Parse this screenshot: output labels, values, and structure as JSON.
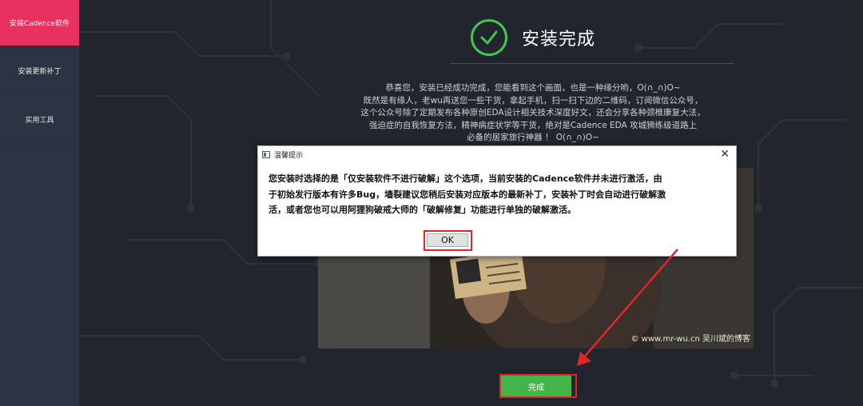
{
  "sidebar": {
    "items": [
      {
        "label": "安装Cadence软件",
        "active": true
      },
      {
        "label": "安装更新补丁",
        "active": false
      },
      {
        "label": "实用工具",
        "active": false
      }
    ]
  },
  "main": {
    "title": "安装完成",
    "title_icon": "check-circle-icon",
    "message_lines": [
      "恭喜您，安装已经成功完成，您能看到这个画面，也是一种缘分哟，O(∩_∩)O~",
      "既然是有缘人，老wu再送您一些干货，拿起手机，扫一扫下边的二维码，订阅微信公众号，",
      "这个公众号除了定期发布各种原创EDA设计相关技术深度好文，还会分享各种颈椎康复大法，",
      "强迫症的自我恢复方法，精神病症状学等干货，绝对是Cadence EDA 攻城狮练级道路上",
      "必备的居家旅行神器 ！ O(∩_∩)O~"
    ],
    "photo_watermark": "© www.mr-wu.cn 吴川斌的博客",
    "done_button": "完成"
  },
  "dialog": {
    "title": "温馨提示",
    "close_glyph": "✕",
    "body_lines": [
      "您安装时选择的是「仅安装软件不进行破解」这个选项，当前安装的Cadence软件并未进行激活，由",
      "于初始发行版本有许多Bug，墙裂建议您稍后安装对应版本的最新补丁，安装补丁时会自动进行破解激",
      "活，或者您也可以用阿狸狗破戒大师的「破解修复」功能进行单独的破解激活。"
    ],
    "ok_button": "OK"
  },
  "colors": {
    "background": "#22252e",
    "sidebar": "#2c3444",
    "sidebar_active": "#e8315f",
    "accent_green": "#3ec94e",
    "done_button": "#43b548",
    "highlight_red": "#e0262b"
  }
}
